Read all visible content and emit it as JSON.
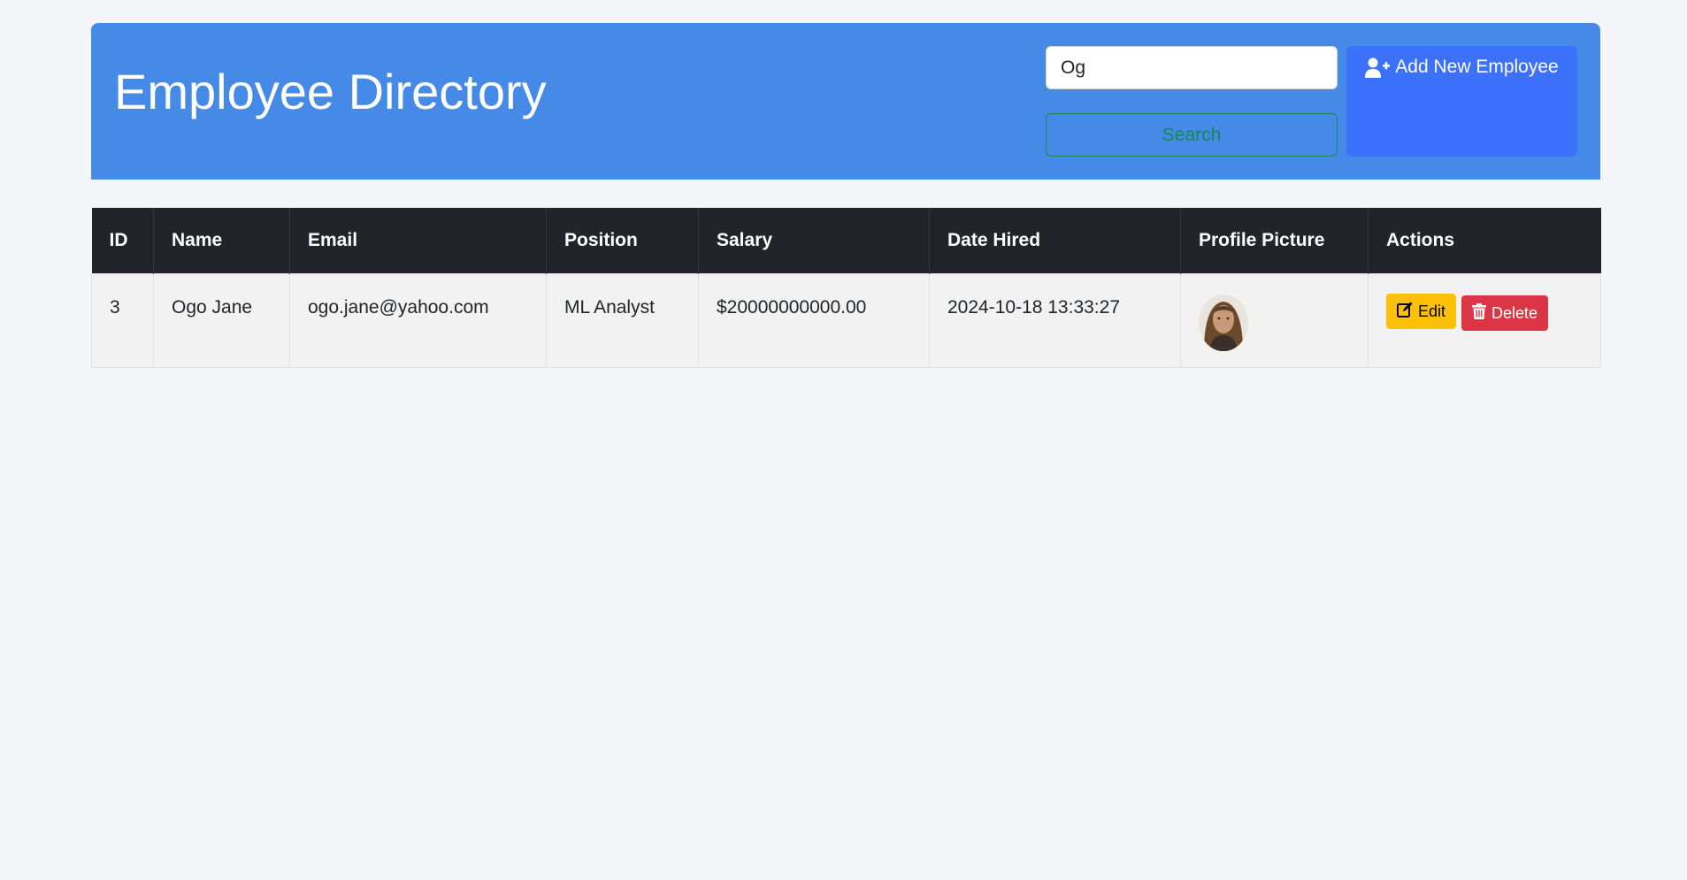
{
  "header": {
    "title": "Employee Directory",
    "search_value": "Og",
    "search_button_label": "Search",
    "add_button_label": "Add New Employee"
  },
  "table": {
    "columns": [
      "ID",
      "Name",
      "Email",
      "Position",
      "Salary",
      "Date Hired",
      "Profile Picture",
      "Actions"
    ],
    "rows": [
      {
        "id": "3",
        "name": "Ogo Jane",
        "email": "ogo.jane@yahoo.com",
        "position": "ML Analyst",
        "salary": "$20000000000.00",
        "date_hired": "2024-10-18 13:33:27",
        "edit_label": "Edit",
        "delete_label": "Delete"
      }
    ]
  },
  "icons": {
    "add": "user-plus-icon",
    "edit": "edit-icon",
    "delete": "trash-icon"
  },
  "colors": {
    "header_bg": "#448ae6",
    "add_button": "#3c71fb",
    "search_outline": "#198754",
    "table_head": "#212529",
    "edit_button": "#ffc107",
    "delete_button": "#dc3545"
  }
}
